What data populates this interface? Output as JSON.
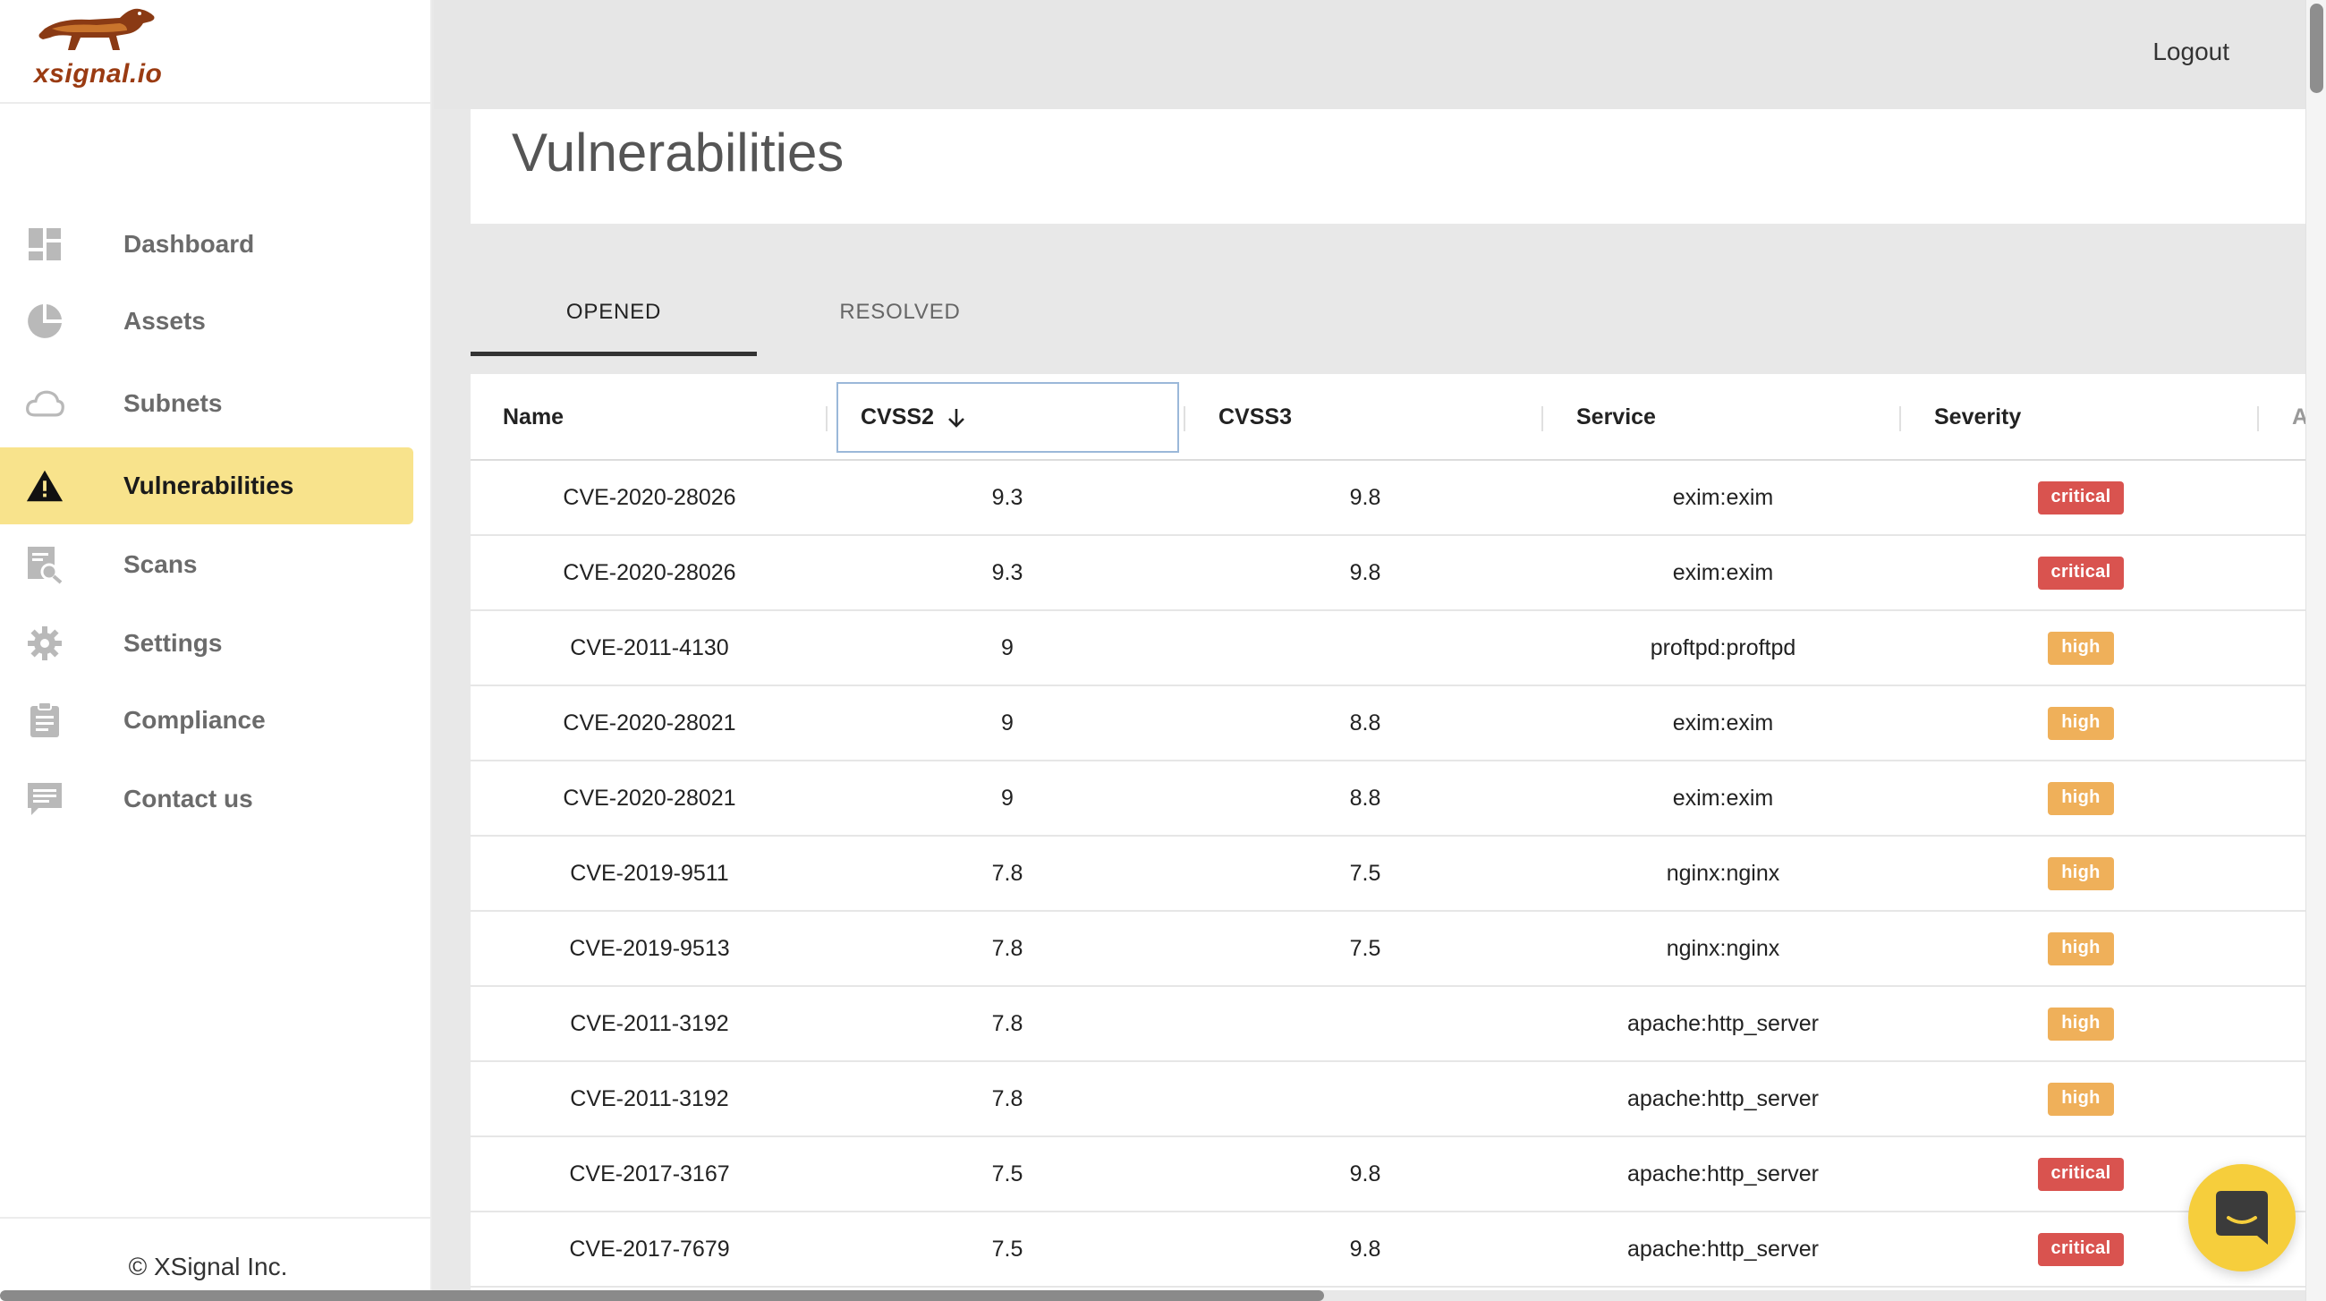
{
  "brand": {
    "name": "xsignal.io",
    "logo_icon": "dachshund-logo",
    "accent": "#9a3b12"
  },
  "sidebar": {
    "items": [
      {
        "label": "Dashboard",
        "icon": "dashboard-icon",
        "active": false
      },
      {
        "label": "Assets",
        "icon": "pie-chart-icon",
        "active": false
      },
      {
        "label": "Subnets",
        "icon": "cloud-icon",
        "active": false
      },
      {
        "label": "Vulnerabilities",
        "icon": "warning-icon",
        "active": true
      },
      {
        "label": "Scans",
        "icon": "scan-search-icon",
        "active": false
      },
      {
        "label": "Settings",
        "icon": "gear-icon",
        "active": false
      },
      {
        "label": "Compliance",
        "icon": "clipboard-icon",
        "active": false
      },
      {
        "label": "Contact us",
        "icon": "chat-icon",
        "active": false
      }
    ],
    "active_color": "#f8e38c",
    "footer": "© XSignal Inc."
  },
  "header": {
    "logout_label": "Logout"
  },
  "page": {
    "title": "Vulnerabilities"
  },
  "tabs": [
    {
      "label": "OPENED",
      "active": true
    },
    {
      "label": "RESOLVED",
      "active": false
    }
  ],
  "table": {
    "columns": {
      "name": "Name",
      "cvss2": "CVSS2",
      "cvss3": "CVSS3",
      "service": "Service",
      "severity": "Severity",
      "assets": "Ass"
    },
    "sort": {
      "column": "CVSS2",
      "direction": "descending",
      "icon": "arrow-down-icon"
    },
    "rows": [
      {
        "name": "CVE-2020-28026",
        "cvss2": "9.3",
        "cvss3": "9.8",
        "service": "exim:exim",
        "severity": "critical"
      },
      {
        "name": "CVE-2020-28026",
        "cvss2": "9.3",
        "cvss3": "9.8",
        "service": "exim:exim",
        "severity": "critical"
      },
      {
        "name": "CVE-2011-4130",
        "cvss2": "9",
        "cvss3": "",
        "service": "proftpd:proftpd",
        "severity": "high"
      },
      {
        "name": "CVE-2020-28021",
        "cvss2": "9",
        "cvss3": "8.8",
        "service": "exim:exim",
        "severity": "high"
      },
      {
        "name": "CVE-2020-28021",
        "cvss2": "9",
        "cvss3": "8.8",
        "service": "exim:exim",
        "severity": "high"
      },
      {
        "name": "CVE-2019-9511",
        "cvss2": "7.8",
        "cvss3": "7.5",
        "service": "nginx:nginx",
        "severity": "high"
      },
      {
        "name": "CVE-2019-9513",
        "cvss2": "7.8",
        "cvss3": "7.5",
        "service": "nginx:nginx",
        "severity": "high"
      },
      {
        "name": "CVE-2011-3192",
        "cvss2": "7.8",
        "cvss3": "",
        "service": "apache:http_server",
        "severity": "high"
      },
      {
        "name": "CVE-2011-3192",
        "cvss2": "7.8",
        "cvss3": "",
        "service": "apache:http_server",
        "severity": "high"
      },
      {
        "name": "CVE-2017-3167",
        "cvss2": "7.5",
        "cvss3": "9.8",
        "service": "apache:http_server",
        "severity": "critical"
      },
      {
        "name": "CVE-2017-7679",
        "cvss2": "7.5",
        "cvss3": "9.8",
        "service": "apache:http_server",
        "severity": "critical"
      }
    ]
  },
  "severity_colors": {
    "critical": "#d9534f",
    "high": "#efb05a"
  },
  "chat_widget": {
    "icon": "chat-bubble-icon",
    "color": "#f6ce3c"
  }
}
